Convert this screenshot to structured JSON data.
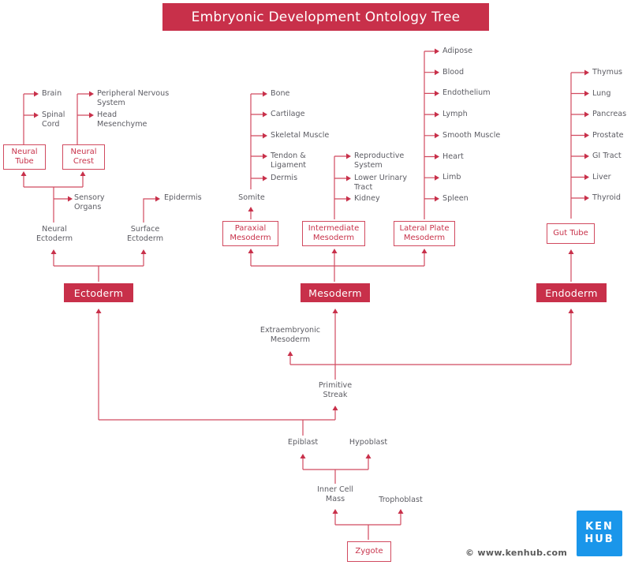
{
  "title": "Embryonic Development Ontology Tree",
  "colors": {
    "accent": "#c8304a",
    "line": "#d14a5f",
    "text": "#5c5c63",
    "logo": "#1a96ea"
  },
  "germ_layers": {
    "ectoderm": "Ectoderm",
    "mesoderm": "Mesoderm",
    "endoderm": "Endoderm"
  },
  "ectoderm": {
    "neural_tube": {
      "line1": "Neural",
      "line2": "Tube",
      "children": [
        [
          "Brain"
        ],
        [
          "Spinal",
          "Cord"
        ]
      ]
    },
    "neural_crest": {
      "line1": "Neural",
      "line2": "Crest",
      "children": [
        [
          "Peripheral Nervous",
          "System"
        ],
        [
          "Head",
          "Mesenchyme"
        ]
      ]
    },
    "neural_ectoderm": {
      "line1": "Neural",
      "line2": "Ectoderm"
    },
    "sensory_organs": {
      "line1": "Sensory",
      "line2": "Organs"
    },
    "surface_ectoderm": {
      "line1": "Surface",
      "line2": "Ectoderm"
    },
    "epidermis": "Epidermis"
  },
  "mesoderm": {
    "paraxial": {
      "line1": "Paraxial",
      "line2": "Mesoderm"
    },
    "somite": "Somite",
    "somite_children": [
      [
        "Bone"
      ],
      [
        "Cartilage"
      ],
      [
        "Skeletal Muscle"
      ],
      [
        "Tendon &",
        "Ligament"
      ],
      [
        "Dermis"
      ]
    ],
    "intermediate": {
      "line1": "Intermediate",
      "line2": "Mesoderm"
    },
    "intermediate_children": [
      [
        "Reproductive",
        "System"
      ],
      [
        "Lower Urinary",
        "Tract"
      ],
      [
        "Kidney"
      ]
    ],
    "lateral_plate": {
      "line1": "Lateral Plate",
      "line2": "Mesoderm"
    },
    "lateral_plate_children": [
      "Adipose",
      "Blood",
      "Endothelium",
      "Lymph",
      "Smooth Muscle",
      "Heart",
      "Limb",
      "Spleen"
    ]
  },
  "endoderm": {
    "gut_tube": "Gut Tube",
    "gut_tube_children": [
      "Thymus",
      "Lung",
      "Pancreas",
      "Prostate",
      "GI Tract",
      "Liver",
      "Thyroid"
    ]
  },
  "early": {
    "extraembryonic": {
      "line1": "Extraembryonic",
      "line2": "Mesoderm"
    },
    "primitive_streak": {
      "line1": "Primitive",
      "line2": "Streak"
    },
    "epiblast": "Epiblast",
    "hypoblast": "Hypoblast",
    "inner_cell_mass": {
      "line1": "Inner Cell",
      "line2": "Mass"
    },
    "trophoblast": "Trophoblast",
    "zygote": "Zygote"
  },
  "footer": {
    "copyright": "© www.kenhub.com",
    "logo_line1": "KEN",
    "logo_line2": "HUB"
  }
}
